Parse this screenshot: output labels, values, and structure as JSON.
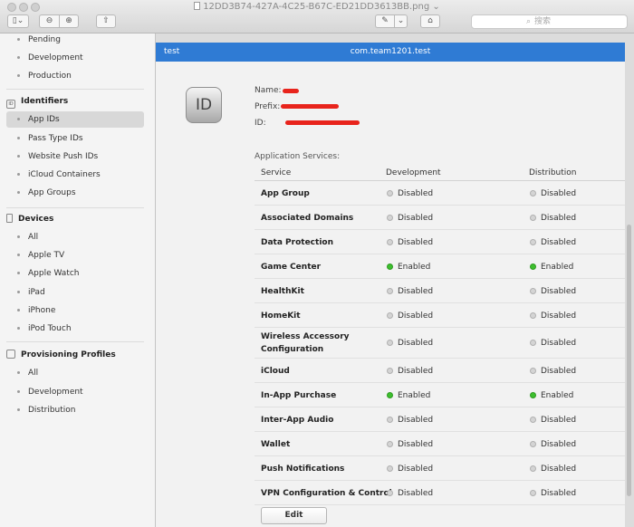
{
  "window": {
    "title": "12DD3B74-427A-4C25-B67C-ED21DD3613BB.png",
    "title_chevron": "⌄"
  },
  "toolbar": {
    "sidebar_toggle": "▯⌄",
    "zoom_out": "⊖",
    "zoom_in": "⊕",
    "share": "⇧",
    "markup": "✎",
    "markup_menu": "⌄",
    "markup_toolbox": "⌂",
    "search_placeholder": "搜索"
  },
  "sidebar": {
    "top_items": [
      "Pending",
      "Development",
      "Production"
    ],
    "identifiers": {
      "label": "Identifiers",
      "icon_text": "ID",
      "items": [
        "App IDs",
        "Pass Type IDs",
        "Website Push IDs",
        "iCloud Containers",
        "App Groups"
      ],
      "selected": "App IDs"
    },
    "devices": {
      "label": "Devices",
      "items": [
        "All",
        "Apple TV",
        "Apple Watch",
        "iPad",
        "iPhone",
        "iPod Touch"
      ]
    },
    "provisioning": {
      "label": "Provisioning Profiles",
      "items": [
        "All",
        "Development",
        "Distribution"
      ]
    }
  },
  "detail": {
    "header_left": "test",
    "header_center": "com.team1201.test",
    "id_icon_text": "ID",
    "name_label": "Name:",
    "prefix_label": "Prefix:",
    "id_label": "ID:",
    "services_label": "Application Services:",
    "columns": [
      "Service",
      "Development",
      "Distribution"
    ],
    "services": [
      {
        "name": "App Group",
        "dev": "Disabled",
        "dist": "Disabled"
      },
      {
        "name": "Associated Domains",
        "dev": "Disabled",
        "dist": "Disabled"
      },
      {
        "name": "Data Protection",
        "dev": "Disabled",
        "dist": "Disabled"
      },
      {
        "name": "Game Center",
        "dev": "Enabled",
        "dist": "Enabled"
      },
      {
        "name": "HealthKit",
        "dev": "Disabled",
        "dist": "Disabled"
      },
      {
        "name": "HomeKit",
        "dev": "Disabled",
        "dist": "Disabled"
      },
      {
        "name": "Wireless Accessory",
        "name2": "Configuration",
        "dev": "Disabled",
        "dist": "Disabled"
      },
      {
        "name": "iCloud",
        "dev": "Disabled",
        "dist": "Disabled"
      },
      {
        "name": "In-App Purchase",
        "dev": "Enabled",
        "dist": "Enabled"
      },
      {
        "name": "Inter-App Audio",
        "dev": "Disabled",
        "dist": "Disabled"
      },
      {
        "name": "Wallet",
        "dev": "Disabled",
        "dist": "Disabled"
      },
      {
        "name": "Push Notifications",
        "dev": "Disabled",
        "dist": "Disabled"
      },
      {
        "name": "VPN Configuration & Control",
        "dev": "Disabled",
        "dist": "Disabled"
      }
    ],
    "edit_button": "Edit"
  },
  "colors": {
    "header_blue": "#2f7bd4",
    "enabled_green": "#3dbf2e",
    "redaction_red": "#e8241c"
  }
}
